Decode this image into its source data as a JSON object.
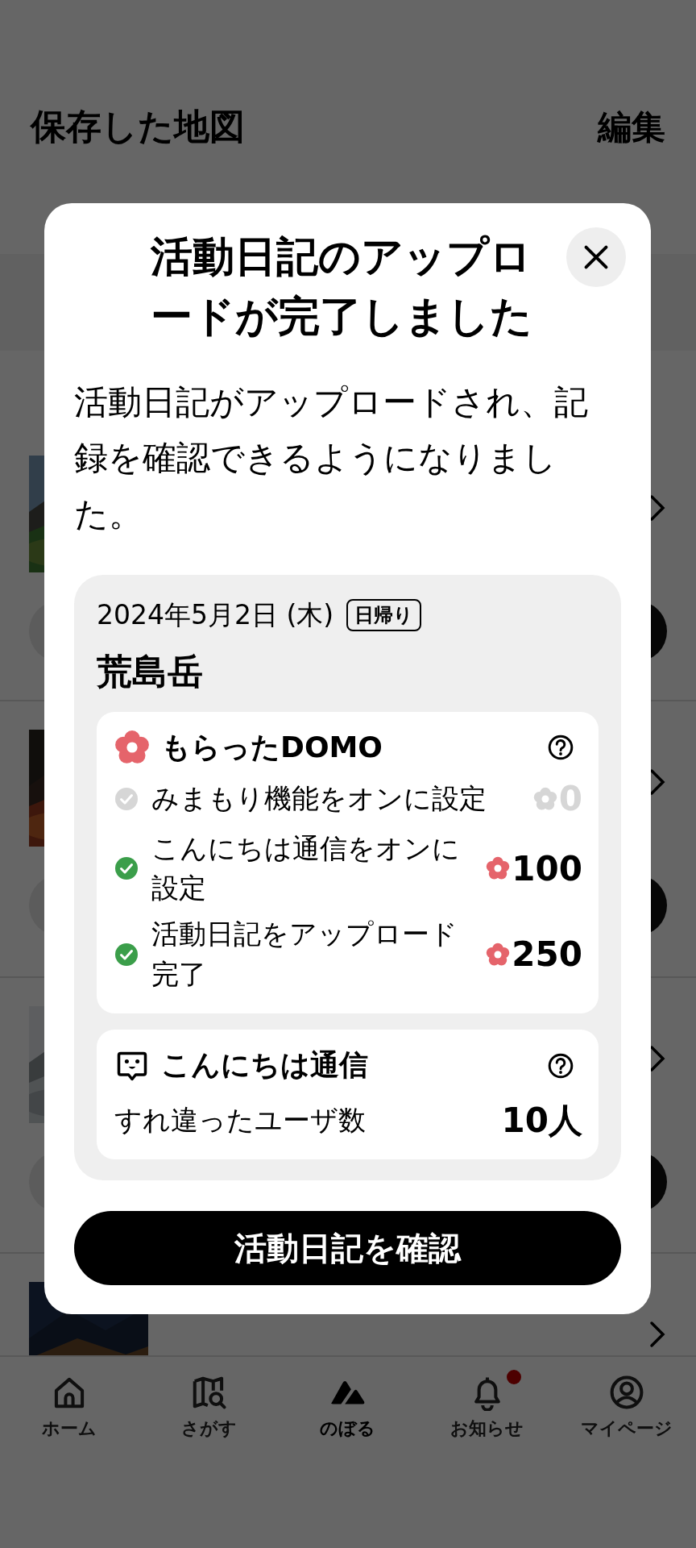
{
  "header": {
    "title": "保存した地図",
    "action": "編集"
  },
  "dialog": {
    "title": "活動日記のアップロードが完了しました",
    "message": "活動日記がアップロードされ、記録を確認できるようになりました。",
    "record": {
      "date": "2024年5月2日 (木)",
      "tag": "日帰り",
      "mountain": "荒島岳"
    },
    "domo": {
      "title": "もらったDOMO",
      "items": [
        {
          "label": "みまもり機能をオンに設定",
          "checked": false,
          "points": "0"
        },
        {
          "label": "こんにちは通信をオンに設定",
          "checked": true,
          "points": "100"
        },
        {
          "label": "活動日記をアップロード完了",
          "checked": true,
          "points": "250"
        }
      ]
    },
    "hello": {
      "title": "こんにちは通信",
      "label": "すれ違ったユーザ数",
      "value": "10人"
    },
    "button": "活動日記を確認"
  },
  "nav": [
    {
      "label": "ホーム",
      "kind": "home",
      "selected": false,
      "dot": false
    },
    {
      "label": "さがす",
      "kind": "map",
      "selected": false,
      "dot": false
    },
    {
      "label": "のぼる",
      "kind": "mountain",
      "selected": true,
      "dot": false
    },
    {
      "label": "お知らせ",
      "kind": "bell",
      "selected": false,
      "dot": true
    },
    {
      "label": "マイページ",
      "kind": "user",
      "selected": false,
      "dot": false
    }
  ]
}
